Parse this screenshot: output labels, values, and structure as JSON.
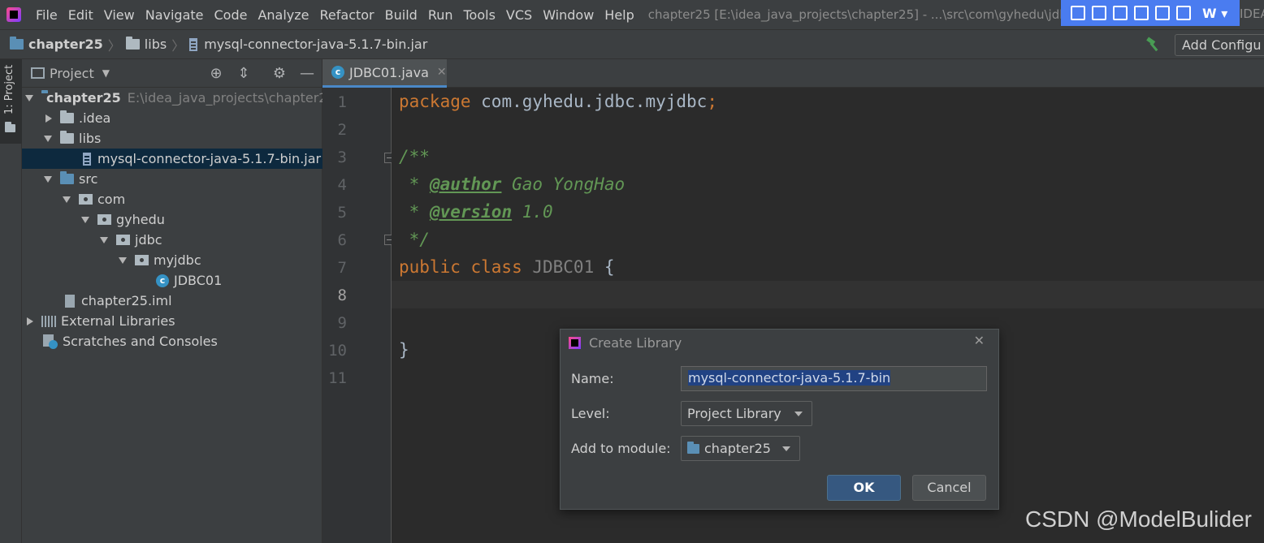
{
  "menubar": {
    "items": [
      "File",
      "Edit",
      "View",
      "Navigate",
      "Code",
      "Analyze",
      "Refactor",
      "Build",
      "Run",
      "Tools",
      "VCS",
      "Window",
      "Help"
    ],
    "title": "chapter25 [E:\\idea_java_projects\\chapter25] - ...\\src\\com\\gyhedu\\jdb",
    "end_text": "IDEA"
  },
  "navbar": {
    "project": "chapter25",
    "folder": "libs",
    "file": "mysql-connector-java-5.1.7-bin.jar",
    "add_config_label": "Add Configu"
  },
  "stripe": {
    "project_tab": "1: Project"
  },
  "project_panel": {
    "title": "Project",
    "tree": [
      {
        "label": "chapter25",
        "path": "E:\\idea_java_projects\\chapter2"
      },
      {
        "label": ".idea"
      },
      {
        "label": "libs"
      },
      {
        "label": "mysql-connector-java-5.1.7-bin.jar"
      },
      {
        "label": "src"
      },
      {
        "label": "com"
      },
      {
        "label": "gyhedu"
      },
      {
        "label": "jdbc"
      },
      {
        "label": "myjdbc"
      },
      {
        "label": "JDBC01"
      },
      {
        "label": "chapter25.iml"
      },
      {
        "label": "External Libraries"
      },
      {
        "label": "Scratches and Consoles"
      }
    ]
  },
  "editor": {
    "tab_label": "JDBC01.java",
    "tab_icon_letter": "c",
    "line_numbers": [
      "1",
      "2",
      "3",
      "4",
      "5",
      "6",
      "7",
      "8",
      "9",
      "10",
      "11"
    ],
    "code": {
      "l1_kw": "package",
      "l1_rest": " com.gyhedu.jdbc.myjdbc",
      "l1_semi": ";",
      "l3": "/**",
      "l4_pre": " * ",
      "l4_tag": "@author",
      "l4_rest": " Gao YongHao",
      "l5_pre": " * ",
      "l5_tag": "@version",
      "l5_rest": " 1.0",
      "l6": " */",
      "l7_kw": "public class",
      "l7_name": " JDBC01 ",
      "l7_brace": "{",
      "l10": "}"
    }
  },
  "dialog": {
    "title": "Create Library",
    "name_label": "Name:",
    "name_value": "mysql-connector-java-5.1.7-bin",
    "level_label": "Level:",
    "level_value": "Project Library",
    "module_label": "Add to module:",
    "module_value": "chapter25",
    "ok_label": "OK",
    "cancel_label": "Cancel"
  },
  "watermark": "CSDN @ModelBulider",
  "colors": {
    "keyword": "#cc7832",
    "doc_comment": "#629755",
    "selection": "#214283",
    "ok_button": "#365880"
  }
}
